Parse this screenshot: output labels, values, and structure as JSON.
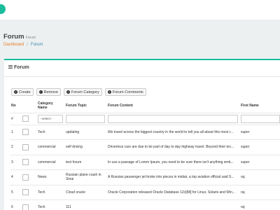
{
  "page": {
    "title": "Forum",
    "subtitle": "Forum",
    "breadcrumb": {
      "home": "Dashboard",
      "separator": "/",
      "current": "Forum"
    }
  },
  "panel": {
    "title": "Forum",
    "accent_color": "#1abc9c"
  },
  "toolbar": {
    "create": "Create",
    "remove": "Remove",
    "forum_category": "Forum Category",
    "forum_comments": "Forum Comments"
  },
  "table": {
    "headers": {
      "no": "No",
      "category": "Category Name",
      "topic": "Forum Topic",
      "content": "Forum Content",
      "first_name": "First Name"
    },
    "filter": {
      "hash": "#",
      "select_placeholder": "--select--"
    },
    "rows": [
      {
        "no": "1",
        "category": "Tech",
        "topic": "updating",
        "content": "We travel across the biggest country in the world to tell you all about this most r...",
        "first_name": "super"
      },
      {
        "no": "2",
        "category": "commercial",
        "topic": "self driving",
        "content": "Driverless cars are due to be part of day to day highway travel. Beyond their tec...",
        "first_name": "super"
      },
      {
        "no": "3",
        "category": "commercial",
        "topic": "test forum",
        "content": "In use a passage of Lorem Ipsum, you need to be sure there isn't anything emb...",
        "first_name": "super"
      },
      {
        "no": "4",
        "category": "News",
        "topic": "Russian plane crash in Sinai",
        "content": "A Russian passenger jet broke into pieces in midair, a top aviation official said S...",
        "first_name": "raj"
      },
      {
        "no": "5",
        "category": "Tech",
        "topic": "Cloud oracle",
        "content": "Oracle Corporation released Oracle Database 12c[88] for Linux, Solaris and Win...",
        "first_name": "raj"
      },
      {
        "no": "6",
        "category": "Tech",
        "topic": "111",
        "content": "",
        "first_name": "raj"
      }
    ]
  }
}
